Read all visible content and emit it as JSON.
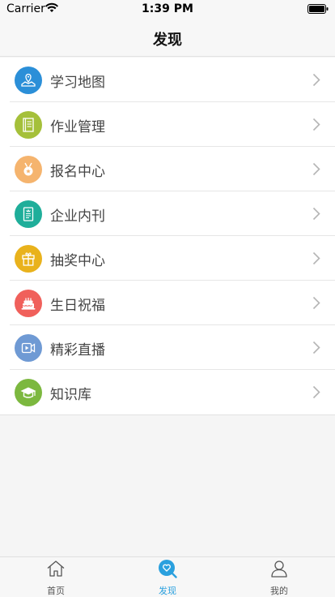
{
  "status_bar": {
    "carrier": "Carrier",
    "time": "1:39 PM"
  },
  "nav": {
    "title": "发现"
  },
  "menu": {
    "items": [
      {
        "label": "学习地图",
        "icon": "map-icon",
        "color": "#2b8fd8"
      },
      {
        "label": "作业管理",
        "icon": "notebook-icon",
        "color": "#a5c03a"
      },
      {
        "label": "报名中心",
        "icon": "medal-icon",
        "color": "#f5b46e"
      },
      {
        "label": "企业内刊",
        "icon": "journal-icon",
        "color": "#1fae9a"
      },
      {
        "label": "抽奖中心",
        "icon": "gift-icon",
        "color": "#e9b21c"
      },
      {
        "label": "生日祝福",
        "icon": "cake-icon",
        "color": "#f0605b"
      },
      {
        "label": "精彩直播",
        "icon": "video-icon",
        "color": "#6f9ad4"
      },
      {
        "label": "知识库",
        "icon": "graduation-cap-icon",
        "color": "#7cb83f"
      }
    ]
  },
  "tabs": [
    {
      "label": "首页",
      "icon": "home-icon",
      "active": false
    },
    {
      "label": "发现",
      "icon": "discover-icon",
      "active": true
    },
    {
      "label": "我的",
      "icon": "profile-icon",
      "active": false
    }
  ],
  "colors": {
    "accent": "#2aa0de"
  }
}
